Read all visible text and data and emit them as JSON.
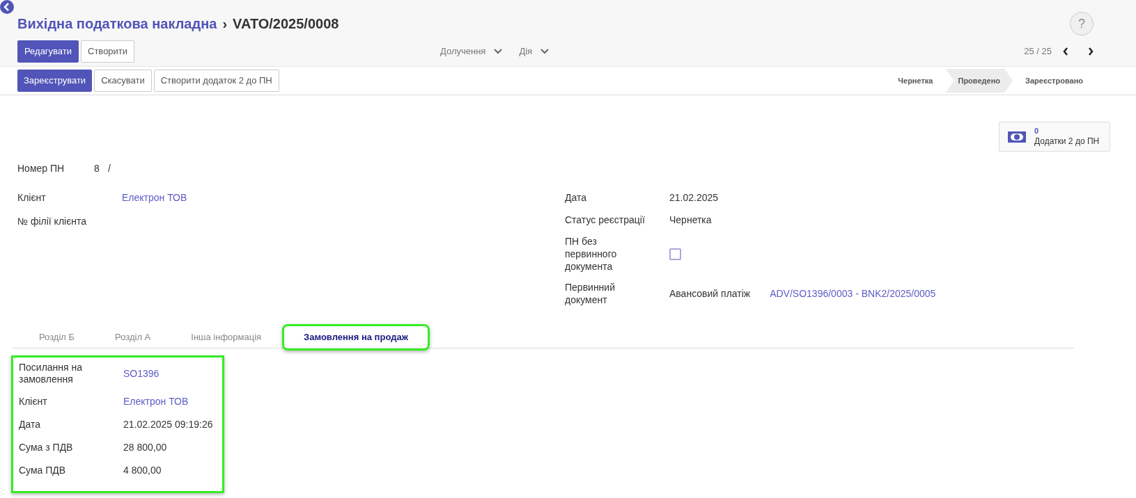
{
  "breadcrumb": {
    "parent": "Вихідна податкова накладна",
    "separator": "›",
    "current": "VATO/2025/0008"
  },
  "toolbar": {
    "primary": "Редагувати",
    "secondary": "Створити",
    "menus": [
      "Долучення",
      "Дія"
    ],
    "pager": "25 / 25"
  },
  "help": "?",
  "actions": [
    {
      "label": "Зареєструвати",
      "primary": true
    },
    {
      "label": "Скасувати",
      "primary": false
    },
    {
      "label": "Створити додаток 2 до ПН",
      "primary": false
    }
  ],
  "statusbar": [
    {
      "label": "Чернетка",
      "selected": false
    },
    {
      "label": "Проведено",
      "selected": true
    },
    {
      "label": "Зареєстровано",
      "selected": false
    }
  ],
  "smart_button": {
    "count": "0",
    "label": "Додатки 2 до ПН"
  },
  "number": {
    "label": "Номер ПН",
    "value": "8",
    "suffix": "/"
  },
  "left_fields": [
    {
      "label": "Клієнт",
      "value": "Електрон ТОВ",
      "kind": "link"
    },
    {
      "label": "№ філії клієнта",
      "kind": "empty"
    }
  ],
  "right_fields": [
    {
      "label": "Дата",
      "value": "21.02.2025",
      "kind": "text"
    },
    {
      "label": "Статус реєстрації",
      "value": "Чернетка",
      "kind": "text"
    },
    {
      "label": "ПН без первинного документа",
      "kind": "checkbox",
      "checked": false
    },
    {
      "label": "Первинний документ",
      "value": "Авансовий платіж",
      "link": "ADV/SO1396/0003 - BNK2/2025/0005",
      "kind": "doc"
    }
  ],
  "tabs": [
    {
      "label": "Розділ Б",
      "selected": false,
      "highlighted": false
    },
    {
      "label": "Розділ А",
      "selected": false,
      "highlighted": false
    },
    {
      "label": "Інша інформація",
      "selected": false,
      "highlighted": false
    },
    {
      "label": "Замовлення на продаж",
      "selected": true,
      "highlighted": true
    }
  ],
  "order_panel": {
    "highlighted": true,
    "fields": [
      {
        "label": "Посилання на замовлення",
        "value": "SO1396",
        "kind": "link"
      },
      {
        "label": "Клієнт",
        "value": "Електрон ТОВ",
        "kind": "link"
      },
      {
        "label": "Дата",
        "value": "21.02.2025 09:19:26",
        "kind": "text"
      },
      {
        "label": "Сума з ПДВ",
        "value": "28 800,00",
        "kind": "text"
      },
      {
        "label": "Сума ПДВ",
        "value": "4 800,00",
        "kind": "text"
      }
    ]
  }
}
